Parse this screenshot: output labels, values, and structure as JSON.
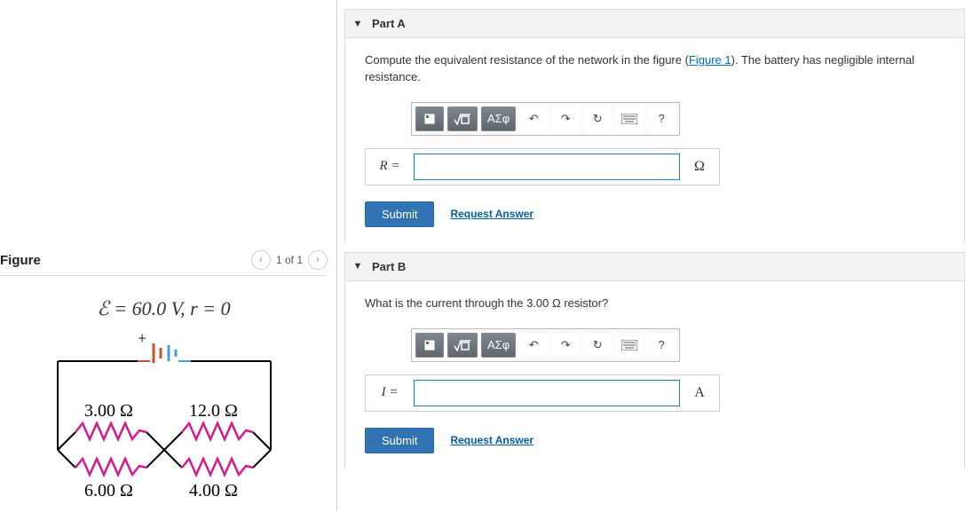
{
  "figure": {
    "title": "Figure",
    "pager": "1 of 1",
    "emf_label": "ℰ = 60.0 V,  r = 0",
    "r1": "3.00 Ω",
    "r2": "12.0 Ω",
    "r3": "6.00 Ω",
    "r4": "4.00 Ω"
  },
  "parts": [
    {
      "title": "Part A",
      "prompt_pre": "Compute the equivalent resistance of the network in the figure (",
      "figure_link": "Figure 1",
      "prompt_post": "). The battery has negligible internal resistance.",
      "lhs": "R =",
      "unit": "Ω",
      "input_value": "",
      "submit": "Submit",
      "request": "Request Answer"
    },
    {
      "title": "Part B",
      "prompt_full": "What is the current through the 3.00 Ω resistor?",
      "lhs": "I =",
      "unit": "A",
      "input_value": "",
      "submit": "Submit",
      "request": "Request Answer"
    }
  ],
  "toolbar": {
    "undo": "↶",
    "redo": "↷",
    "reset": "↻",
    "help": "?",
    "greek": "ΑΣφ"
  }
}
